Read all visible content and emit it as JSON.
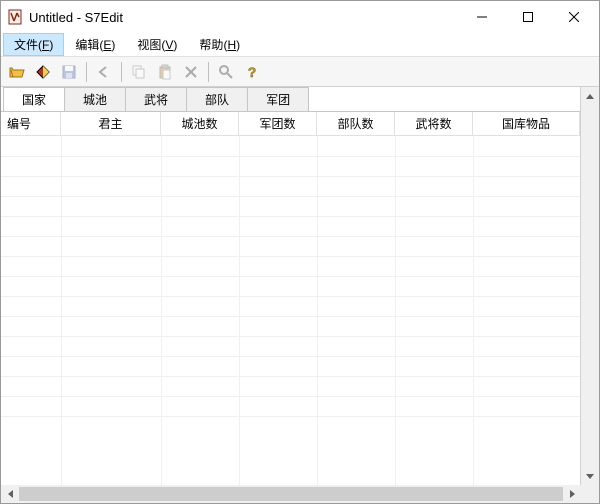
{
  "window": {
    "title": "Untitled - S7Edit"
  },
  "menu": {
    "file": {
      "label": "文件",
      "hotkey": "F"
    },
    "edit": {
      "label": "编辑",
      "hotkey": "E"
    },
    "view": {
      "label": "视图",
      "hotkey": "V"
    },
    "help": {
      "label": "帮助",
      "hotkey": "H"
    }
  },
  "tabs": {
    "country": "国家",
    "city": "城池",
    "general": "武将",
    "troop": "部队",
    "corps": "军团"
  },
  "columns": {
    "id": "编号",
    "lord": "君主",
    "city_count": "城池数",
    "corps_count": "军团数",
    "troop_count": "部队数",
    "general_count": "武将数",
    "treasury": "国库物品"
  },
  "rows": []
}
